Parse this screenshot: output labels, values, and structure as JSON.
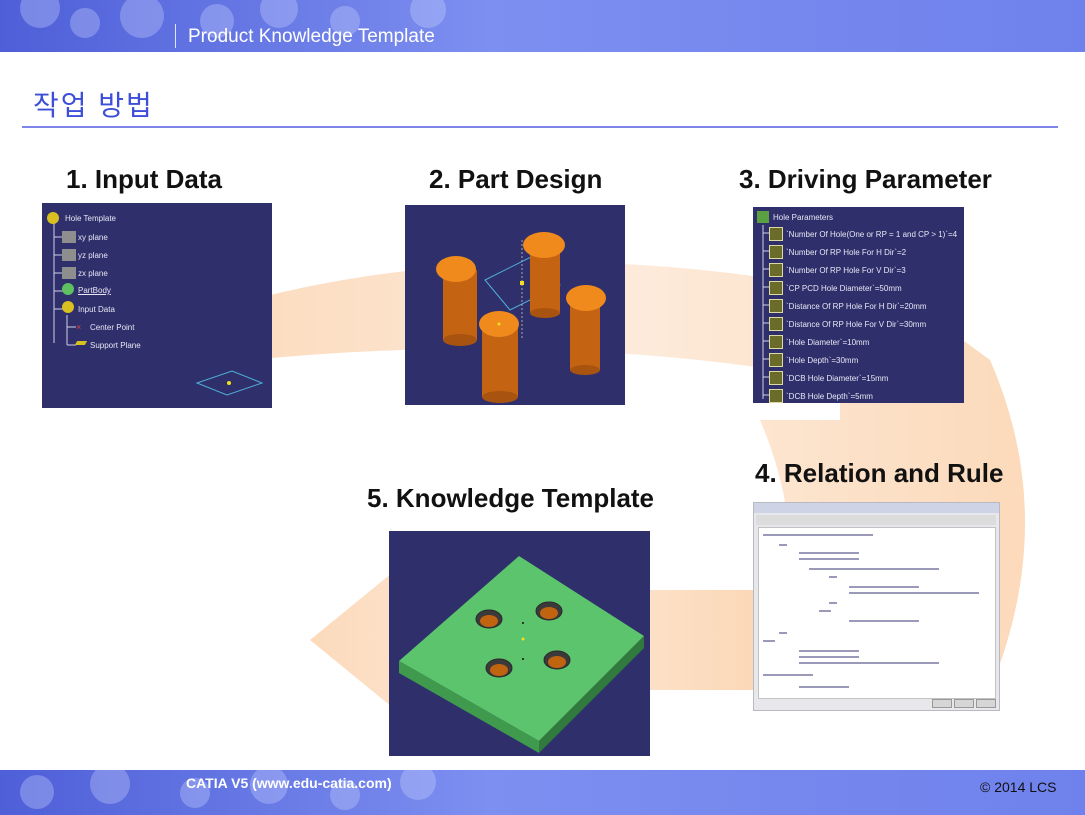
{
  "header": {
    "title": "Product Knowledge Template"
  },
  "heading": "작업 방법",
  "steps": {
    "s1": "1. Input Data",
    "s2": "2. Part Design",
    "s3": "3. Driving Parameter",
    "s4": "4. Relation and Rule",
    "s5": "5. Knowledge Template"
  },
  "input_tree": {
    "root": "Hole Template",
    "items": [
      "xy plane",
      "yz plane",
      "zx plane",
      "PartBody",
      "Input Data",
      "Center Point",
      "Support Plane"
    ]
  },
  "parameters": {
    "root": "Hole Parameters",
    "items": [
      "`Number Of Hole(One or RP = 1 and CP > 1)`=4",
      "`Number Of RP Hole For H Dir`=2",
      "`Number Of RP Hole For V Dir`=3",
      "`CP PCD Hole Diameter`=50mm",
      "`Distance Of RP Hole For H Dir`=20mm",
      "`Distance Of RP Hole For V Dir`=30mm",
      "`Hole Diameter`=10mm",
      "`Hole Depth`=30mm",
      "`DCB Hole Diameter`=15mm",
      "`DCB Hole Depth`=5mm"
    ]
  },
  "footer": {
    "left": "CATIA V5 (www.edu-catia.com)",
    "right": "© 2014 LCS"
  },
  "colors": {
    "accent": "#3d4ed8",
    "bar": "#6f81ec",
    "panel": "#2f2f6b",
    "orange": "#f08a1c",
    "plate": "#5cc46c"
  }
}
